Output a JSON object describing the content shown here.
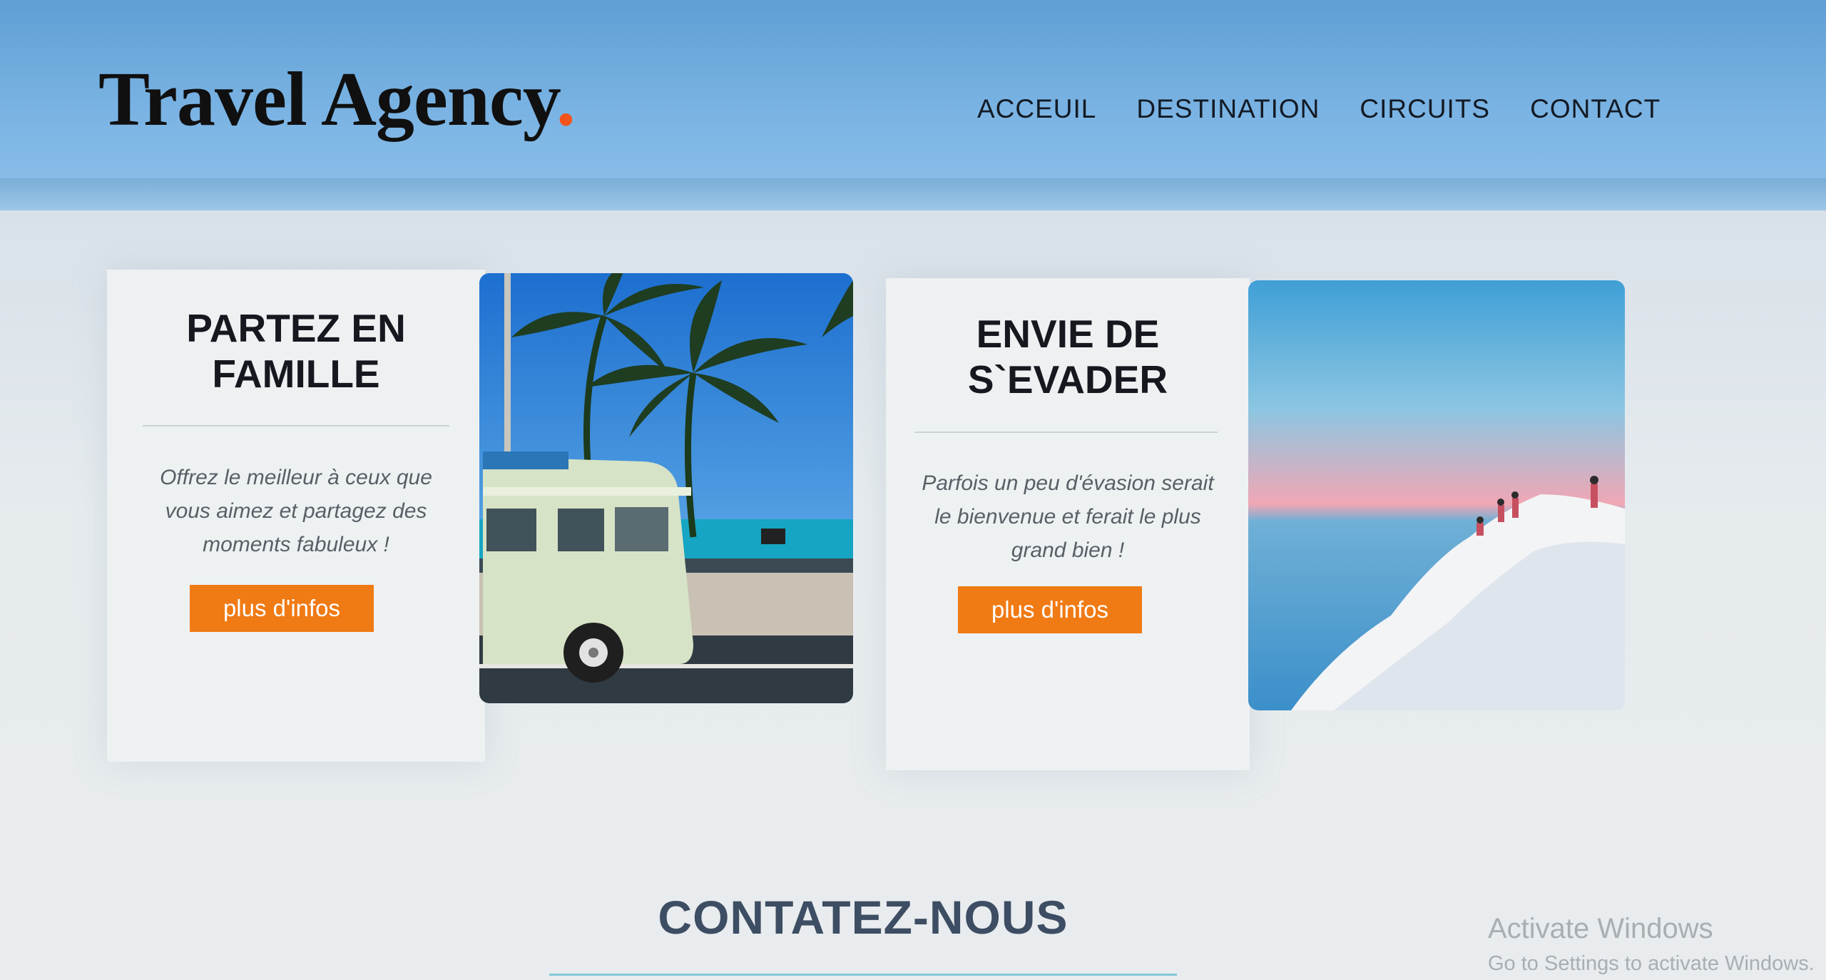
{
  "header": {
    "logo_text": "Travel Agency",
    "logo_dot": ".",
    "nav": [
      "ACCEUIL",
      "DESTINATION",
      "CIRCUITS",
      "CONTACT"
    ]
  },
  "cards": [
    {
      "title": "PARTEZ EN FAMILLE",
      "text": "Offrez le meilleur à ceux que vous aimez et partagez des moments fabuleux !",
      "button": "plus d'infos",
      "image": "beach-van-palm-trees"
    },
    {
      "title": "ENVIE DE S`EVADER",
      "text": "Parfois un peu d'évasion serait le bienvenue et ferait le plus grand bien !",
      "button": "plus d'infos",
      "image": "white-cliffs-sea-sunset"
    }
  ],
  "contact": {
    "title": "CONTATEZ-NOUS"
  },
  "watermark": {
    "line1": "Activate Windows",
    "line2": "Go to Settings to activate Windows."
  },
  "colors": {
    "header_blue": "#6aa8dc",
    "accent_orange": "#f07a14",
    "logo_dot": "#f2541b",
    "contact_title": "#3d4d63"
  }
}
